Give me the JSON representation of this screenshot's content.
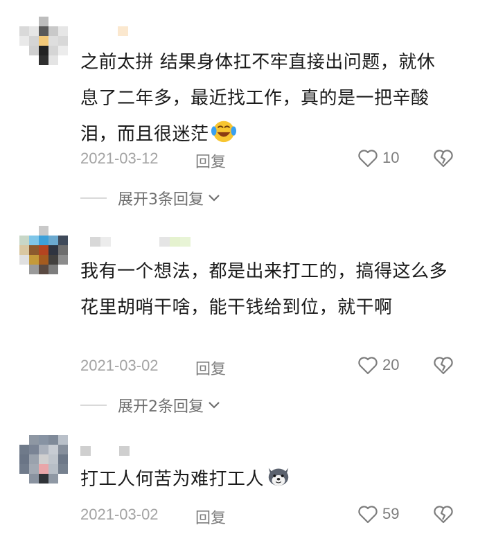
{
  "comments": [
    {
      "text": "之前太拼 结果身体扛不牢直接出问题，就休息了二年多，最近找工作，真的是一把辛酸泪，而且很迷茫",
      "emoji": "crying-laughing-emoji",
      "date": "2021-03-12",
      "reply_label": "回复",
      "likes": "10",
      "expand_label": "展开3条回复"
    },
    {
      "text": "我有一个想法，都是出来打工的，搞得这么多花里胡哨干啥，能干钱给到位，就干啊",
      "date": "2021-03-02",
      "reply_label": "回复",
      "likes": "20",
      "expand_label": "展开2条回复"
    },
    {
      "text": "打工人何苦为难打工人",
      "emoji": "husky-dog-emoji",
      "date": "2021-03-02",
      "reply_label": "回复",
      "likes": "59"
    }
  ],
  "colors": {
    "text": "#1b1b1b",
    "meta": "#a4a4a4",
    "icon": "#7d7d7d"
  }
}
